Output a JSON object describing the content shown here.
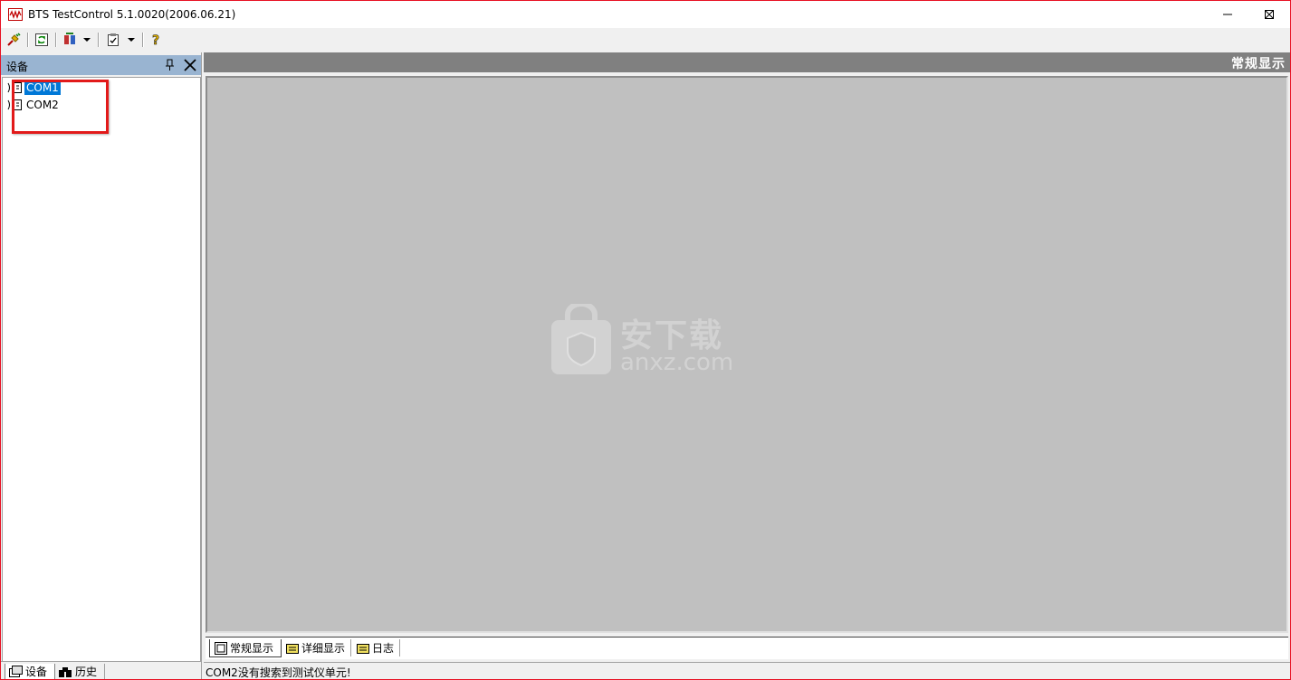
{
  "window": {
    "title": "BTS TestControl 5.1.0020(2006.06.21)",
    "border_color": "#e81123"
  },
  "toolbar": {
    "buttons": [
      {
        "name": "connect",
        "icon": "plug-icon"
      },
      {
        "name": "refresh",
        "icon": "refresh-icon"
      },
      {
        "name": "devices",
        "icon": "device-settings-icon",
        "has_dropdown": true
      },
      {
        "name": "checklist",
        "icon": "checklist-icon",
        "has_dropdown": true
      },
      {
        "name": "help",
        "icon": "help-icon"
      }
    ]
  },
  "left_panel": {
    "title": "设备",
    "tree": [
      {
        "label": "COM1",
        "selected": true,
        "icon": "serial-port-icon"
      },
      {
        "label": "COM2",
        "selected": false,
        "icon": "serial-port-icon"
      }
    ],
    "tabs": [
      {
        "label": "设备",
        "active": true,
        "icon": "device-icon"
      },
      {
        "label": "历史",
        "active": false,
        "icon": "binoculars-icon"
      }
    ]
  },
  "main": {
    "header_title": "常规显示",
    "tabs": [
      {
        "label": "常规显示",
        "active": true,
        "icon": "view-icon"
      },
      {
        "label": "详细显示",
        "active": false,
        "icon": "folder-icon"
      },
      {
        "label": "日志",
        "active": false,
        "icon": "folder-icon"
      }
    ],
    "background_color": "#c0c0c0"
  },
  "watermark": {
    "text": "安下载",
    "sub": "anxz.com"
  },
  "status": {
    "message": "COM2没有搜索到测试仪单元!"
  },
  "colors": {
    "selection": "#0078d7",
    "panel_header": "#99b4d1",
    "annotation_box": "#e21a1a"
  }
}
